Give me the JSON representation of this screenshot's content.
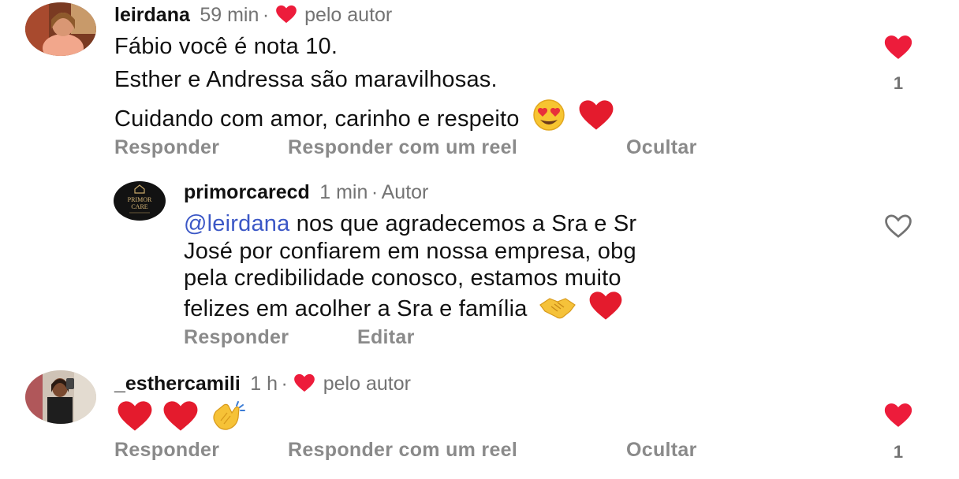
{
  "comments": [
    {
      "username": "leirdana",
      "time": "59 min",
      "liked_by_author_label": "pelo autor",
      "lines": [
        "Fábio você é nota 10.",
        "Esther e Andressa são maravilhosas.",
        "Cuidando com amor, carinho e respeito"
      ],
      "like_count": "1",
      "liked": true,
      "actions": {
        "reply": "Responder",
        "reply_reel": "Responder com um reel",
        "hide": "Ocultar"
      }
    },
    {
      "username": "primorcarecd",
      "time": "1 min",
      "role": "Autor",
      "mention": "@leirdana",
      "lines": [
        " nos que agradecemos a Sra e Sr",
        "José por confiarem em nossa empresa, obg",
        "pela credibilidade conosco, estamos muito",
        "felizes em acolher a Sra e família"
      ],
      "avatar_text": [
        "PRIMOR",
        "CARE"
      ],
      "liked": false,
      "actions": {
        "reply": "Responder",
        "edit": "Editar"
      }
    },
    {
      "username": "_esthercamili",
      "time": "1 h",
      "liked_by_author_label": "pelo autor",
      "like_count": "1",
      "liked": true,
      "actions": {
        "reply": "Responder",
        "reply_reel": "Responder com um reel",
        "hide": "Ocultar"
      }
    }
  ],
  "meta_separator": "·",
  "colors": {
    "heart_red": "#ed1c3b",
    "mention_blue": "#3b57c6",
    "muted_text": "#737373",
    "action_text": "#8a8a8a"
  },
  "icons": {
    "heart": "heart-icon",
    "heart_outline": "heart-outline-icon",
    "heart_eyes": "heart-eyes-emoji",
    "handshake": "handshake-emoji",
    "clap": "clapping-hands-emoji"
  }
}
